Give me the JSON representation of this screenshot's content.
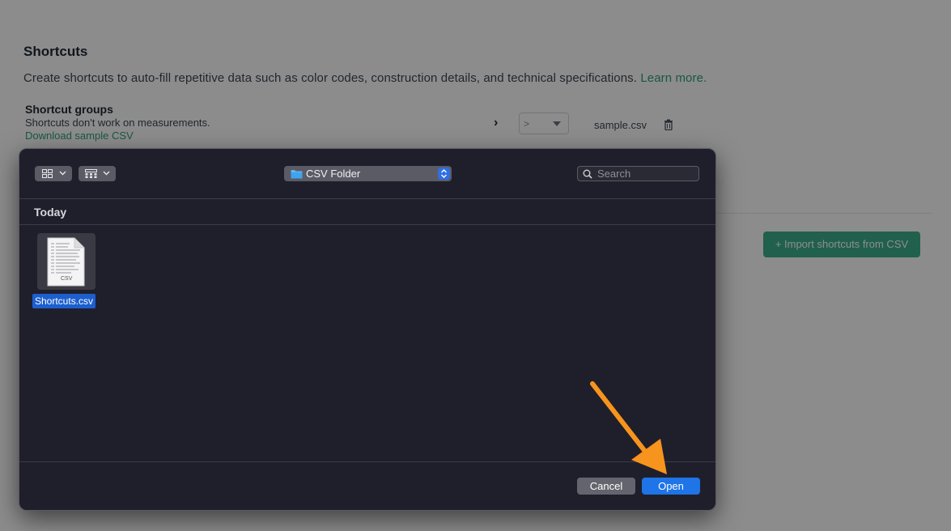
{
  "background_page": {
    "title": "Shortcuts",
    "description": "Create shortcuts to auto-fill repetitive data such as color codes, construction details, and technical specifications.",
    "learn_more": "Learn more.",
    "groups": {
      "title": "Shortcut groups",
      "note": "Shortcuts don't work on measurements.",
      "download_link": "Download sample CSV",
      "select_value": ">",
      "file_name": "sample.csv"
    },
    "import_button": "+ Import shortcuts from CSV",
    "accent_color": "#3daf8d"
  },
  "dialog": {
    "location": "CSV Folder",
    "search_placeholder": "Search",
    "section": "Today",
    "files": [
      {
        "name": "Shortcuts.csv",
        "icon": "csv-file-icon",
        "thumb_text": "CSV",
        "selected": true
      }
    ],
    "cancel_label": "Cancel",
    "open_label": "Open",
    "primary_color": "#1f74e8"
  },
  "annotation": {
    "arrow_color": "#f7941d",
    "arrow_icon": "pointer-arrow-icon"
  }
}
